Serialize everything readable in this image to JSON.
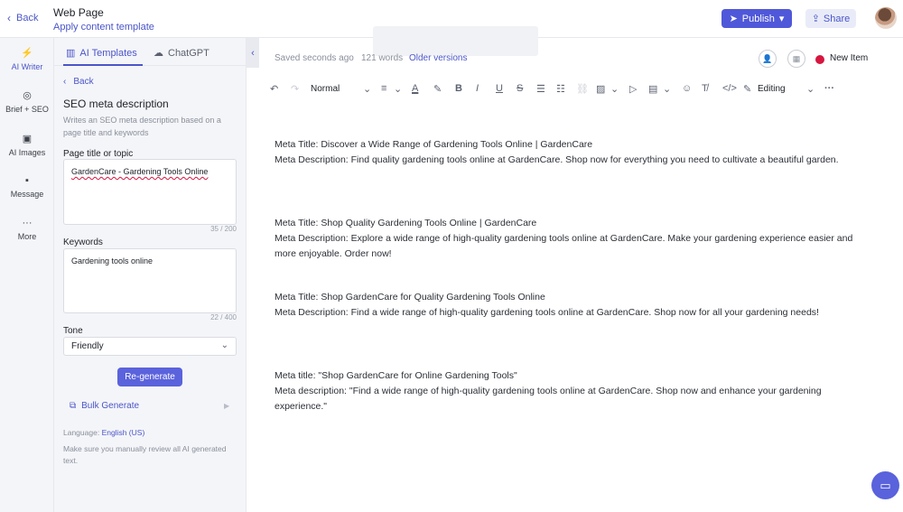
{
  "header": {
    "back_label": "Back",
    "title": "Web Page",
    "subtitle": "Apply content template",
    "publish_label": "Publish",
    "share_label": "Share"
  },
  "rail": {
    "items": [
      {
        "label": "AI Writer",
        "icon": "lightning-icon"
      },
      {
        "label": "Brief + SEO",
        "icon": "target-icon"
      },
      {
        "label": "AI Images",
        "icon": "image-icon"
      },
      {
        "label": "Message",
        "icon": "chat-icon"
      },
      {
        "label": "More",
        "icon": "more-icon"
      }
    ]
  },
  "panel": {
    "tabs": [
      {
        "label": "AI Templates",
        "icon": "grid-icon"
      },
      {
        "label": "ChatGPT",
        "icon": "chat-icon"
      }
    ],
    "back_label": "Back",
    "template_title": "SEO meta description",
    "template_desc": "Writes an SEO meta description based on a page title and keywords",
    "page_title_label": "Page title or topic",
    "page_title_value": "GardenCare - Gardening Tools Online",
    "page_title_count": "35 / 200",
    "keywords_label": "Keywords",
    "keywords_value": "Gardening tools online",
    "keywords_count": "22 / 400",
    "tone_label": "Tone",
    "tone_value": "Friendly",
    "regenerate_label": "Re-generate",
    "bulk_label": "Bulk Generate",
    "language_prefix": "Language:",
    "language_value": "English (US)",
    "review_note": "Make sure you manually review all AI generated text."
  },
  "editor": {
    "save_status": "Saved seconds ago",
    "word_count": "121 words",
    "older_versions": "Older versions",
    "new_item_label": "New Item",
    "style_select": "Normal",
    "mode_select": "Editing",
    "paragraphs": [
      {
        "title": "Meta Title: Discover a Wide Range of Gardening Tools Online | GardenCare",
        "desc": "Meta Description: Find quality gardening tools online at GardenCare. Shop now for everything you need to cultivate a beautiful garden."
      },
      {
        "title": "Meta Title: Shop Quality Gardening Tools Online | GardenCare",
        "desc": "Meta Description: Explore a wide range of high-quality gardening tools online at GardenCare. Make your gardening experience easier and more enjoyable. Order now!"
      },
      {
        "title": "Meta Title: Shop GardenCare for Quality Gardening Tools Online",
        "desc": "Meta Description: Find a wide range of high-quality gardening tools online at GardenCare. Shop now for all your gardening needs!"
      },
      {
        "title": "Meta title: \"Shop GardenCare for Online Gardening Tools\"",
        "desc": "Meta description: \"Find a wide range of high-quality gardening tools online at GardenCare. Shop now and enhance your gardening experience.\""
      }
    ]
  },
  "colors": {
    "accent": "#4f58d9",
    "status_dot": "#d6163f"
  }
}
